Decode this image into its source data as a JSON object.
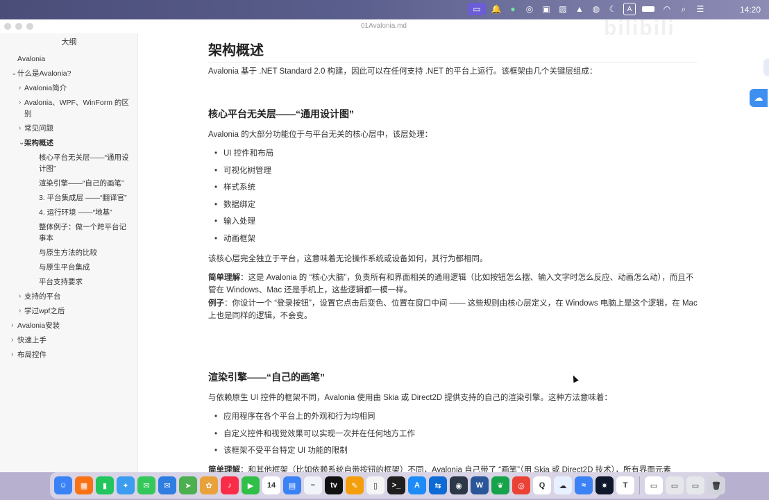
{
  "menubar": {
    "apple_glyph": "",
    "clock": "14:20",
    "status_icons": [
      "screen-share-icon",
      "notification-bell-icon",
      "leaf-app-icon",
      "dial-icon",
      "record-icon",
      "image-icon",
      "weather-icon",
      "vpn-icon",
      "moon-icon",
      "input-method-icon",
      "battery-icon",
      "wifi-icon",
      "search-icon",
      "control-center-icon"
    ],
    "input_method_label": "A"
  },
  "window": {
    "doc_title": "01Avalonia.md",
    "watermark": "bilibili"
  },
  "sidebar": {
    "title": "大纲",
    "items": [
      {
        "label": "Avalonia",
        "level": 0,
        "chevron": ""
      },
      {
        "label": "什么是Avalonia?",
        "level": 0,
        "chevron": "⌄"
      },
      {
        "label": "Avalonia简介",
        "level": 1,
        "chevron": "›"
      },
      {
        "label": "Avalonia、WPF、WinForm 的区别",
        "level": 1,
        "chevron": "›"
      },
      {
        "label": "常见问题",
        "level": 1,
        "chevron": "›"
      },
      {
        "label": "架构概述",
        "level": 1,
        "chevron": "⌄"
      },
      {
        "label": "核心平台无关层——“通用设计图”",
        "level": 2,
        "chevron": ""
      },
      {
        "label": "渲染引擎——“自己的画笔”",
        "level": 2,
        "chevron": ""
      },
      {
        "label": "3. 平台集成层 ——“翻译官”",
        "level": 2,
        "chevron": ""
      },
      {
        "label": "4. 运行环境 ——“地基”",
        "level": 2,
        "chevron": ""
      },
      {
        "label": "整体例子：做一个跨平台记事本",
        "level": 2,
        "chevron": ""
      },
      {
        "label": "与原生方法的比较",
        "level": 2,
        "chevron": ""
      },
      {
        "label": "与原生平台集成",
        "level": 2,
        "chevron": ""
      },
      {
        "label": "平台支持要求",
        "level": 2,
        "chevron": ""
      },
      {
        "label": "支持的平台",
        "level": 1,
        "chevron": "›"
      },
      {
        "label": "学过wpf之后",
        "level": 1,
        "chevron": "›"
      },
      {
        "label": "Avalonia安装",
        "level": 0,
        "chevron": "›"
      },
      {
        "label": "快速上手",
        "level": 0,
        "chevron": "›"
      },
      {
        "label": "布局控件",
        "level": 0,
        "chevron": "›"
      }
    ]
  },
  "content": {
    "h1": "架构概述",
    "intro": "Avalonia 基于 .NET Standard 2.0 构建，因此可以在任何支持 .NET 的平台上运行。该框架由几个关键层组成：",
    "section1": {
      "heading": "核心平台无关层——“通用设计图”",
      "lead": "Avalonia 的大部分功能位于与平台无关的核心层中，该层处理：",
      "bullets": [
        "UI 控件和布局",
        "可视化树管理",
        "样式系统",
        "数据绑定",
        "输入处理",
        "动画框架"
      ],
      "summary": "该核心层完全独立于平台，这意味着无论操作系统或设备如何，其行为都相同。",
      "simple_label": "简单理解",
      "simple_text": "：这是 Avalonia 的 “核心大脑”，负责所有和界面相关的通用逻辑（比如按钮怎么摆、输入文字时怎么反应、动画怎么动），而且不管在 Windows、Mac 还是手机上，这些逻辑都一模一样。",
      "example_label": "例子",
      "example_text": "：你设计一个 “登录按钮”，设置它点击后变色、位置在窗口中间 —— 这些规则由核心层定义，在 Windows 电脑上是这个逻辑，在 Mac 上也是同样的逻辑，不会变。"
    },
    "section2": {
      "heading": "渲染引擎——“自己的画笔”",
      "lead": "与依赖原生 UI 控件的框架不同，Avalonia 使用由 Skia 或 Direct2D 提供支持的自己的渲染引擎。这种方法意味着：",
      "bullets": [
        "应用程序在各个平台上的外观和行为均相同",
        "自定义控件和视觉效果可以实现一次并在任何地方工作",
        "该框架不受平台特定 UI 功能的限制"
      ],
      "cut_label": "简单理解",
      "cut_text": "：和其他框架（比如依赖系统自带按钮的框架）不同，Avalonia 自己带了 “画笔”（用 Skia 或 Direct2D 技术），所有界面元素"
    }
  },
  "dock": {
    "apps": [
      {
        "name": "finder-icon",
        "color": "#3b82f6",
        "glyph": "☺"
      },
      {
        "name": "launchpad-icon",
        "color": "#f97316",
        "glyph": "▦"
      },
      {
        "name": "numbers-icon",
        "color": "#22c55e",
        "glyph": "▮"
      },
      {
        "name": "safari-icon",
        "color": "#3b9cf0",
        "glyph": "✦"
      },
      {
        "name": "messages-icon",
        "color": "#34c759",
        "glyph": "✉"
      },
      {
        "name": "mail-icon",
        "color": "#2f7de1",
        "glyph": "✉"
      },
      {
        "name": "maps-icon",
        "color": "#4caf50",
        "glyph": "➤"
      },
      {
        "name": "photos-icon",
        "color": "#e9a23b",
        "glyph": "✿"
      },
      {
        "name": "music-icon",
        "color": "#fa2d48",
        "glyph": "♪"
      },
      {
        "name": "facetime-icon",
        "color": "#30c048",
        "glyph": "▶"
      },
      {
        "name": "calendar-icon",
        "color": "#ffffff",
        "glyph": "14"
      },
      {
        "name": "files-icon",
        "color": "#3b82f6",
        "glyph": "▤"
      },
      {
        "name": "freeform-icon",
        "color": "#f1f5f9",
        "glyph": "~"
      },
      {
        "name": "appletv-icon",
        "color": "#111111",
        "glyph": "tv"
      },
      {
        "name": "pages-icon",
        "color": "#f59e0b",
        "glyph": "✎"
      },
      {
        "name": "iphone-mirroring-icon",
        "color": "#f5f5f5",
        "glyph": "▯"
      },
      {
        "name": "terminal-icon",
        "color": "#1f1f1f",
        "glyph": ">_"
      },
      {
        "name": "app-store-icon",
        "color": "#1d8cf8",
        "glyph": "A"
      },
      {
        "name": "teamviewer-icon",
        "color": "#0e6bd6",
        "glyph": "⇆"
      },
      {
        "name": "screen-recorder-icon",
        "color": "#2d3748",
        "glyph": "◉"
      },
      {
        "name": "word-icon",
        "color": "#2b579a",
        "glyph": "W"
      },
      {
        "name": "leaf-icon",
        "color": "#16a34a",
        "glyph": "❦"
      },
      {
        "name": "chrome-icon",
        "color": "#ea4335",
        "glyph": "◎"
      },
      {
        "name": "qq-icon",
        "color": "#ffffff",
        "glyph": "Q"
      },
      {
        "name": "baidu-netdisk-icon",
        "color": "#e8f1ff",
        "glyph": "☁"
      },
      {
        "name": "feishu-icon",
        "color": "#3b82f6",
        "glyph": "≈"
      },
      {
        "name": "chatgpt-icon",
        "color": "#0f172a",
        "glyph": "✷"
      },
      {
        "name": "typora-icon",
        "color": "#ffffff",
        "glyph": "T"
      },
      {
        "name": "document-icon",
        "color": "#ffffff",
        "glyph": "▭"
      },
      {
        "name": "window-thumbnail-icon",
        "color": "#e5e7eb",
        "glyph": "▭"
      },
      {
        "name": "window-thumbnail-2-icon",
        "color": "#e5e7eb",
        "glyph": "▭"
      },
      {
        "name": "trash-icon",
        "color": "#d1d5db",
        "glyph": "🗑"
      }
    ]
  }
}
